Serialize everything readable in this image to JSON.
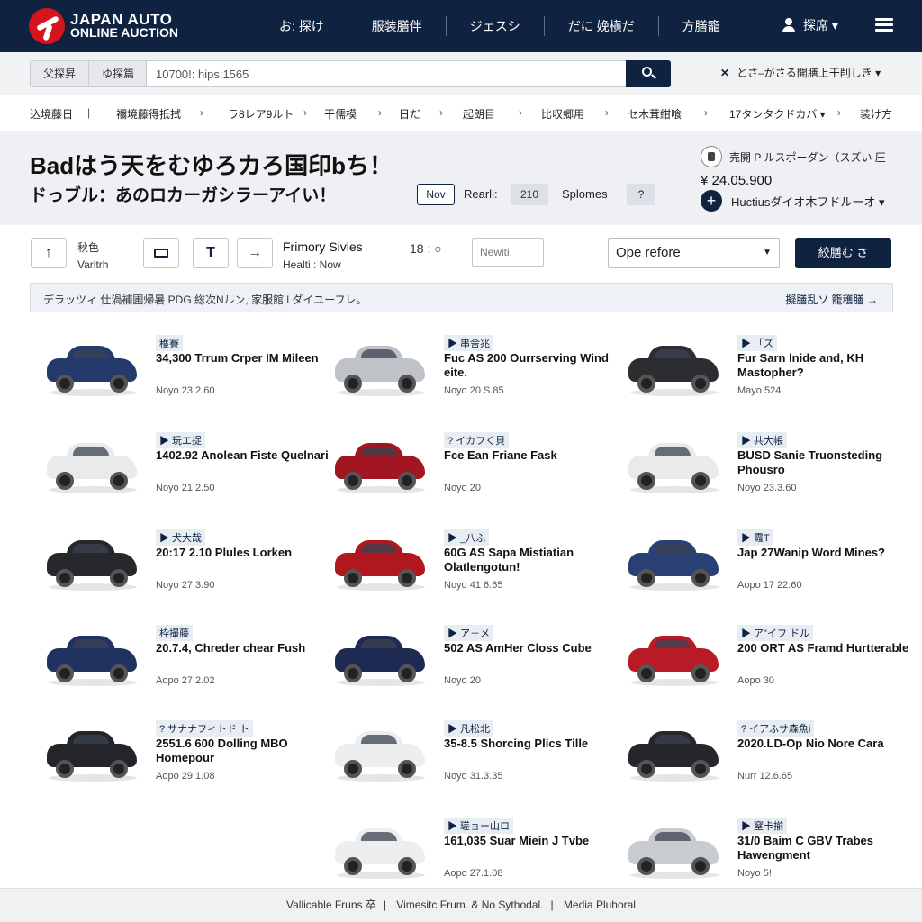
{
  "brand": {
    "line1": "JAPAN AUTO",
    "line2": "ONLINE AUCTION"
  },
  "topnav": [
    "お: 探け",
    "服装膳伴",
    "ジェスシ",
    "だに 娩横だ",
    "方膳籠"
  ],
  "user": {
    "label": "探席 ▾"
  },
  "search": {
    "seg1": "父探昇",
    "seg2": "ゆ探篇",
    "value": "10700!: hips:1565",
    "placeholder": "10700!: hips:1565"
  },
  "language": {
    "label": "とさ–がさる開膳上干削しき ▾"
  },
  "categories": [
    "込境藤日",
    "禰境藤得抵拭",
    "ラ8レア9ルト",
    "干儒模",
    "日だ",
    "起朗目",
    "比収郷用",
    "セ木茸紺喰",
    "17タンタクドカバ ▾",
    "装け方"
  ],
  "hero": {
    "title": "Badはう天をむゆろカろ国印bち！",
    "subtitle": "ドっブル：あのロカーガシラーアイい！",
    "pill_nov": "Nov",
    "rearli": "Rearli:",
    "pill_210": "210",
    "splomes": "Splomes",
    "pill_arrow": "?",
    "right_line1": "売開 P ルスポーダン（スズい 圧",
    "price": "¥ 24.05.900",
    "right_line3": "Huctiusダイオ木フドルーオ ▾"
  },
  "toolbar": {
    "up_icon": "↑",
    "sort_label": "秋色",
    "sort_sub": "Varitrh",
    "t_btn": "T",
    "arrow_btn": "→",
    "primary_label": "Frimory Sivles",
    "primary_sub": "Healti : Now",
    "counter": "18 :  ○",
    "new_placeholder": "Newiti.",
    "select_value": "Ope refore",
    "apply_label": "絞膳む さ"
  },
  "notice": {
    "text": "デラッツィ 仕渦補圃帰暑 PDG 総次Nルン, 家服館 l ダイユーフレ。",
    "link": "擬膳乱ソ 籠穫膳 →"
  },
  "listings": [
    {
      "tag": "穫賽",
      "title": "34,300 Trrum Crper IM Mileen",
      "price": "Noyo 23.2.60",
      "color": "#233a6b"
    },
    {
      "tag": "▶ 串舎兆",
      "title": "Fuc AS 200 Ourrserving Wind eite.",
      "price": "Noyo 20 S.85",
      "color": "#bfc3c8"
    },
    {
      "tag": "▶ 「ズ",
      "title": "Fur Sarn lnide and, KH Mastopher?",
      "price": "Mayo 524",
      "color": "#2b2d31"
    },
    {
      "tag": "▶ 玩エ捉",
      "title": "1402.92 Anolean Fiste Quelnari",
      "price": "Noyo 21.2.50",
      "color": "#e8eaec"
    },
    {
      "tag": "?  イカフく貝",
      "title": "Fce Ean Friane Fask",
      "price": "Noyo 20",
      "color": "#a11620"
    },
    {
      "tag": "▶ 共大帳",
      "title": "BUSD Sanie Truonsteding Phousro",
      "price": "Noyo 23.3.60",
      "color": "#e8eaec"
    },
    {
      "tag": "▶ 犬大哉",
      "title": "20:17 2.10 Plules Lorken",
      "price": "Noyo 27.3.90",
      "color": "#26282c"
    },
    {
      "tag": "▶ _八ふ",
      "title": "60G AS Sapa Mistiatian Olatlengotun!",
      "price": "Noyo 41 6.65",
      "color": "#b0171f"
    },
    {
      "tag": "▶ 霞T",
      "title": "Jap 27Wanip Word Mines?",
      "price": "Aopo 17 22.60",
      "color": "#2a3f74"
    },
    {
      "tag": "枠撮藤",
      "title": "20.7.4, Chreder chear Fush",
      "price": "Aopo 27.2.02",
      "color": "#1f3260"
    },
    {
      "tag": "▶ ア－メ",
      "title": "502 AS AmHer Closs Cube",
      "price": "Noyo 20",
      "color": "#1d2a52"
    },
    {
      "tag": "▶ ア\"イフ ドル",
      "title": "200 ORT AS Framd Hurtterable",
      "price": "Aopo 30",
      "color": "#b81b25"
    },
    {
      "tag": "? サナナフィトド ト",
      "title": "2551.6 600 Dolling MBO Homepour",
      "price": "Aopo 29.1.08",
      "color": "#23252a"
    },
    {
      "tag": "▶ 凡松北",
      "title": "35-8.5 Shorcing Plics Tille",
      "price": "Noyo 31.3.35",
      "color": "#eceef0"
    },
    {
      "tag": "?  イアふサ森魚i",
      "title": "2020.LD-Op Nio Nore Cara",
      "price": "Nurr 12.6.65",
      "color": "#25272b"
    },
    {
      "tag": "▶ 瑳ョー山ロ",
      "title": "161,035 Suar Miein J Tvbe",
      "price": "Aopo 27.1.08",
      "color": "#eceef0"
    },
    {
      "tag": "▶ 窒卡揃",
      "title": "31/0 Baim C GBV Trabes Hawengment",
      "price": "Noyo 5!",
      "color": "#c8ccd1"
    }
  ],
  "footer": [
    "Vallicable Fruns 卒",
    "Vimesitc Frum. & No Sythodal.",
    "Media Pluhoral"
  ],
  "colors": {
    "navy": "#0f2340",
    "brand_red": "#d6141d"
  }
}
